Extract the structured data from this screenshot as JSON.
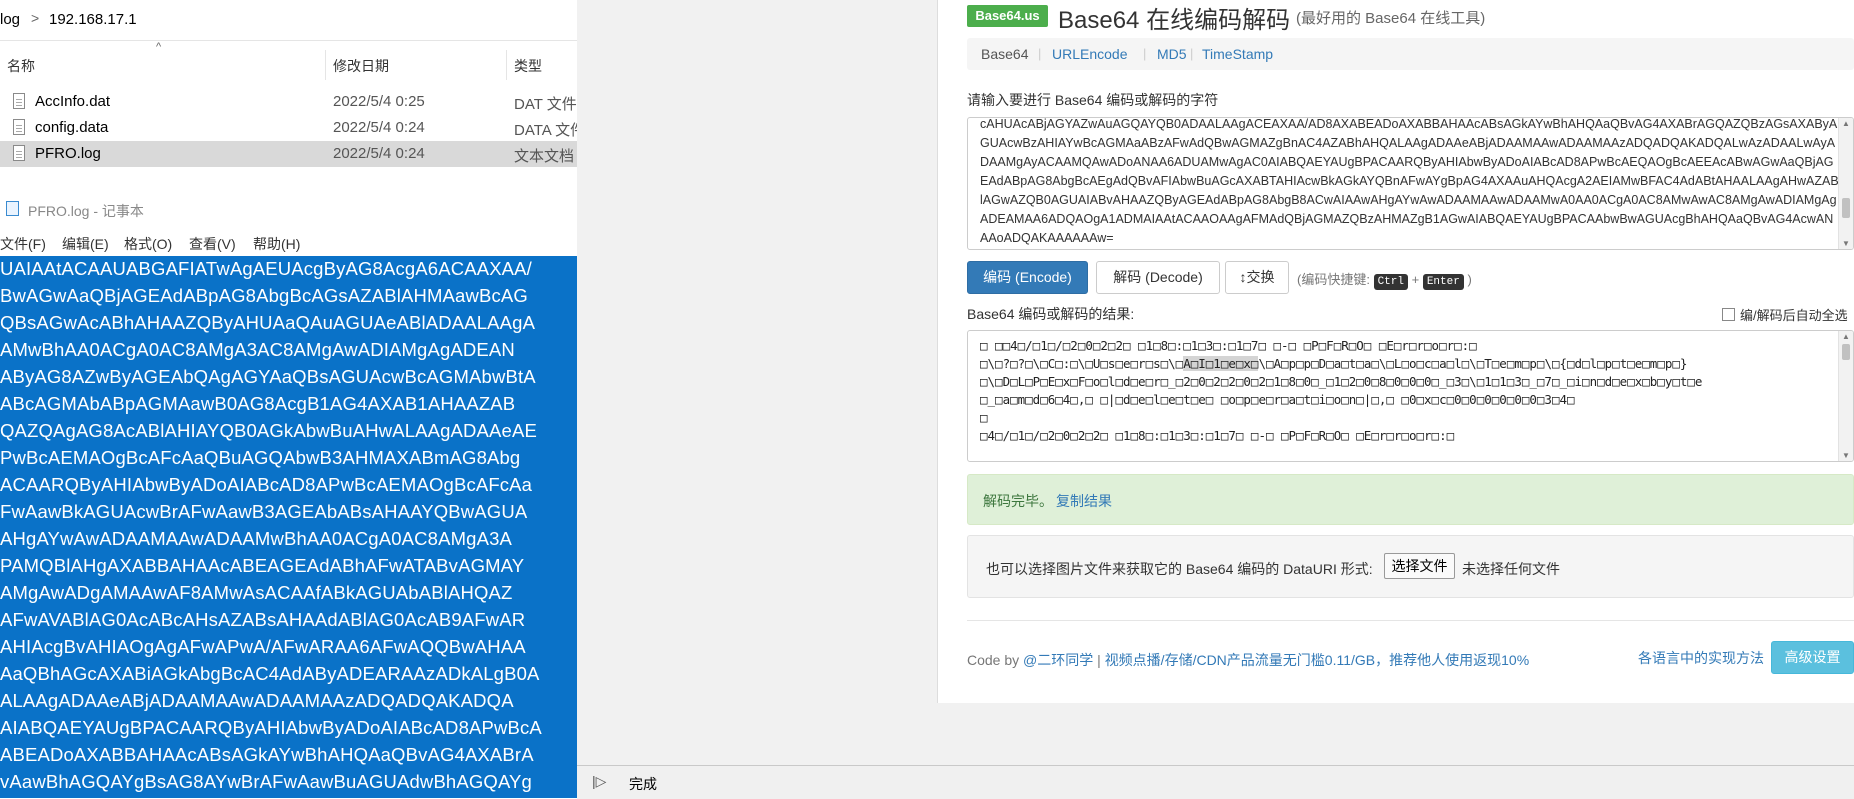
{
  "explorer": {
    "address": {
      "seg1": "log",
      "seg2": "192.168.17.1"
    },
    "columns": {
      "name": "名称",
      "date": "修改日期",
      "type": "类型"
    },
    "files": [
      {
        "name": "AccInfo.dat",
        "date": "2022/5/4 0:25",
        "type": "DAT 文件"
      },
      {
        "name": "config.data",
        "date": "2022/5/4 0:24",
        "type": "DATA 文件"
      },
      {
        "name": "PFRO.log",
        "date": "2022/5/4 0:24",
        "type": "文本文档"
      }
    ]
  },
  "notepad": {
    "title": "PFRO.log - 记事本",
    "menu": [
      "文件(F)",
      "编辑(E)",
      "格式(O)",
      "查看(V)",
      "帮助(H)"
    ],
    "lines": [
      "UAIAAtACAAUABGAFIATwAgAEUAcgByAG8AcgA6ACAAXAA/",
      "BwAGwAaQBjAGEAdABpAG8AbgBcAGsAZABlAHMAawBcAG",
      "QBsAGwAcABhAHAAZQByAHUAaQAuAGUAeABlADAALAAgA",
      "AMwBhAA0ACgA0AC8AMgA3AC8AMgAwADIAMgAgADEAN",
      "AByAG8AZwByAGEAbQAgAGYAaQBsAGUAcwBcAGMAbwBtA",
      "ABcAGMAbABpAGMAawB0AG8AcgB1AG4AXAB1AHAAZAB",
      "QAZQAgAG8AcABlAHIAYQB0AGkAbwBuAHwALAAgADAAeAE",
      "PwBcAEMAOgBcAFcAaQBuAGQAbwB3AHMAXABmAG8Abg",
      "ACAARQByAHIAbwByADoAIABcAD8APwBcAEMAOgBcAFcAa",
      "FwAawBkAGUAcwBrAFwAawB3AGEAbABsAHAAYQBwAGUA",
      "AHgAYwAwADAAMAAwADAAMwBhAA0ACgA0AC8AMgA3A",
      "PAMQBlAHgAXABBAHAAcABEAGEAdABhAFwATABvAGMAY",
      "AMgAwADgAMAAwAF8AMwAsACAAfABkAGUAbABlAHQAZ",
      "AFwAVABlAG0AcABcAHsAZABsAHAAdABlAG0AcAB9AFwAR",
      "AHIAcgBvAHIAOgAgAFwAPwA/AFwARAA6AFwAQQBwAHAA",
      "AaQBhAGcAXABiAGkAbgBcAC4AdAByADEARAAzADkALgB0A",
      "ALAAgADAAeABjADAAMAAwADAAMAAzADQADQAKADQA",
      "AIABQAEYAUgBPACAARQByAHIAbwByADoAIABcAD8APwBcA",
      "ABEADoAXABBAHAAcABsAGkAYwBhAHQAaQBvAG4AXABrA",
      "vAawBhAGQAYgBsAG8AYwBrAFwAawBuAGUAdwBhAGQAYg"
    ]
  },
  "site": {
    "brand": "Base64.us",
    "title": "Base64 在线编码解码",
    "subtitle": "(最好用的 Base64 在线工具)",
    "nav": {
      "base64": "Base64",
      "urlencode": "URLEncode",
      "md5": "MD5",
      "timestamp": "TimeStamp"
    },
    "input_label": "请输入要进行 Base64 编码或解码的字符",
    "input_text": "cAHUAcABjAGYAZwAuAGQAYQB0ADAALAAgACEAXAA/AD8AXABEADoAXABBAHAAcABsAGkAYwBhAHQAaQBvAG4AXABrAGQAZQBzAGsAXAByAGUAcwBzAHIAYwBcAGMAaABzAFwAdQBwAGMAZgBnAC4AZABhAHQALAAgADAAeABjADAAMAAwADAAMAAzADQADQAKADQALwAzADAALwAyADAAMgAyACAAMQAwADoANAA6ADUAMwAgAC0AIABQAEYAUgBPACAARQByAHIAbwByADoAIABcAD8APwBcAEQAOgBcAEEAcABwAGwAaQBjAGEAdABpAG8AbgBcAEgAdQBvAFIAbwBuAGcAXABTAHIAcwBkAGkAYQBnAFwAYgBpAG4AXAAuAHQAcgA2AEIAMwBFAC4AdABtAHAALAAgAHwAZABlAGwAZQB0AGUAIABvAHAAZQByAGEAdABpAG8AbgB8ACwAIAAwAHgAYwAwADAAMAAwADAAMwA0AA0ACgA0AC8AMwAwAC8AMgAwADIAMgAgADEAMAA6ADQAOgA1ADMAIAAtACAAOAAgAFMAdQBjAGMAZQBzAHMAZgB1AGwAIABQAEYAUgBPACAAbwBwAGUAcgBhAHQAaQBvAG4AcwANAAoADQAKAAAAAAw=",
    "btn_encode": "编码 (Encode)",
    "btn_decode": "解码 (Decode)",
    "btn_swap": "↕交换",
    "shortcut": {
      "prefix": "(编码快捷键:",
      "key1": "Ctrl",
      "plus": "+",
      "key2": "Enter",
      "suffix": ")"
    },
    "result_label": "Base64 编码或解码的结果:",
    "auto_copy": "编/解码后自动全选",
    "result": {
      "line1": "□ □□4□/□1□/□2□0□2□2□ □1□8□:□1□3□:□1□7□ □-□ □P□F□R□O□ □E□r□r□o□r□:□",
      "line2a": "□\\□?□?□\\□C□:□\\□U□s□e□r□s□\\□",
      "line2b": "A□I□1□e□x□",
      "line2c": "\\□A□p□p□D□a□t□a□\\□L□o□c□a□l□\\□T□e□m□p□\\□{□d□l□p□t□e□m□p□}",
      "line3": "□\\□D□L□P□E□x□F□o□l□d□e□r□_□2□0□2□2□0□2□1□8□0□_□1□2□0□8□0□0□0□_□3□\\□1□1□3□_□7□_□i□n□d□e□x□b□y□t□e",
      "line4": "□_□a□m□d□6□4□,□ □|□d□e□l□e□t□e□ □o□p□e□r□a□t□i□o□n□|□,□ □0□x□c□0□0□0□0□0□0□3□4□",
      "line5": "□",
      "line6": "□4□/□1□/□2□0□2□2□ □1□8□:□1□3□:□1□7□ □-□ □P□F□R□O□ □E□r□r□o□r□:□"
    },
    "notice": {
      "text": "解码完毕。",
      "link": "复制结果"
    },
    "file": {
      "text": "也可以选择图片文件来获取它的 Base64 编码的 DataURI 形式:",
      "button": "选择文件",
      "no_file": "未选择任何文件"
    },
    "footer": {
      "prefix": "Code by ",
      "author": "@二环同学",
      "sep": " | ",
      "ad": "视频点播/存储/CDN产品流量无门槛0.11/GB，推荐他人使用返现10%",
      "impl": "各语言中的实现方法",
      "advanced": "高级设置"
    }
  },
  "status": {
    "text": "完成"
  }
}
